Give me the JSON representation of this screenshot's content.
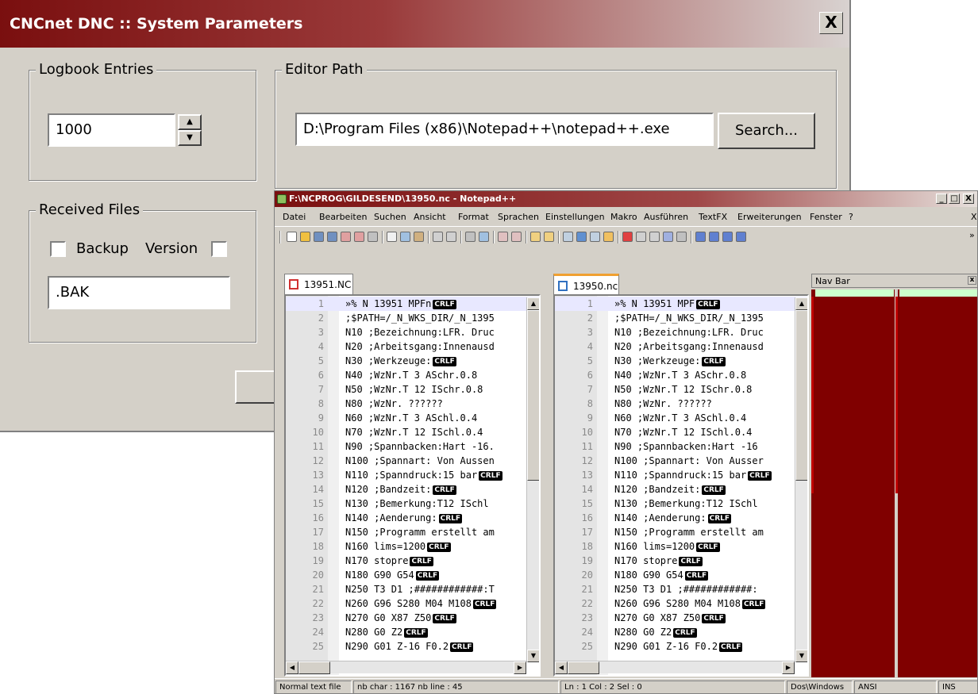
{
  "dialog": {
    "title": "CNCnet DNC :: System Parameters",
    "close_label": "X",
    "logbook": {
      "legend": "Logbook Entries",
      "value": "1000"
    },
    "editor": {
      "legend": "Editor Path",
      "path": "D:\\Program Files (x86)\\Notepad++\\notepad++.exe",
      "search_label": "Search..."
    },
    "received": {
      "legend": "Received Files",
      "backup_label": "Backup",
      "version_label": "Version",
      "extension": ".BAK"
    }
  },
  "npp": {
    "title": "F:\\NCPROG\\GILDESEND\\13950.nc - Notepad++",
    "window_buttons": {
      "minimize": "_",
      "maximize": "□",
      "close": "X"
    },
    "menu": [
      "Datei",
      "Bearbeiten",
      "Suchen",
      "Ansicht",
      "Format",
      "Sprachen",
      "Einstellungen",
      "Makro",
      "Ausführen",
      "TextFX",
      "Erweiterungen",
      "Fenster",
      "?"
    ],
    "menu_right": "X",
    "toolbar_more": "»",
    "left_tab": "13951.NC",
    "right_tab": "13950.nc",
    "crlf_label": "CRLF",
    "line_numbers": [
      "1",
      "2",
      "3",
      "4",
      "5",
      "6",
      "7",
      "8",
      "9",
      "10",
      "11",
      "12",
      "13",
      "14",
      "15",
      "16",
      "17",
      "18",
      "19",
      "20",
      "21",
      "22",
      "23",
      "24",
      "25"
    ],
    "left_lines": [
      "»% N 13951 MPFn",
      ";$PATH=/_N_WKS_DIR/_N_1395",
      "N10 ;Bezeichnung:LFR. Druc",
      "N20 ;Arbeitsgang:Innenausd",
      "N30 ;Werkzeuge:",
      "N40 ;WzNr.T 3 ASchr.0.8",
      "N50 ;WzNr.T 12 ISchr.0.8",
      "N80 ;WzNr. ??????",
      "N60 ;WzNr.T 3 ASchl.0.4",
      "N70 ;WzNr.T 12 ISchl.0.4",
      "N90 ;Spannbacken:Hart -16.",
      "N100 ;Spannart: Von Aussen",
      "N110 ;Spanndruck:15 bar",
      "N120 ;Bandzeit:",
      "N130 ;Bemerkung:T12 ISchl",
      "N140 ;Aenderung:",
      "N150 ;Programm erstellt am",
      "N160 lims=1200",
      "N170 stopre",
      "N180 G90 G54",
      "N250 T3 D1 ;############:T",
      "N260 G96 S280 M04 M108",
      "N270 G0 X87 Z50",
      "N280 G0 Z2",
      "N290 G01 Z-16 F0.2"
    ],
    "right_lines": [
      "»% N 13951 MPF",
      ";$PATH=/_N_WKS_DIR/_N_1395",
      "N10 ;Bezeichnung:LFR. Druc",
      "N20 ;Arbeitsgang:Innenausd",
      "N30 ;Werkzeuge:",
      "N40 ;WzNr.T 3 ASchr.0.8",
      "N50 ;WzNr.T 12 ISchr.0.8",
      "N80 ;WzNr. ??????",
      "N60 ;WzNr.T 3 ASchl.0.4",
      "N70 ;WzNr.T 12 ISchl.0.4",
      "N90 ;Spannbacken:Hart -16",
      "N100 ;Spannart: Von Ausser",
      "N110 ;Spanndruck:15 bar",
      "N120 ;Bandzeit:",
      "N130 ;Bemerkung:T12 ISchl",
      "N140 ;Aenderung:",
      "N150 ;Programm erstellt am",
      "N160 lims=1200",
      "N170 stopre",
      "N180 G90 G54",
      "N250 T3 D1 ;############:",
      "N260 G96 S280 M04 M108",
      "N270 G0 X87 Z50",
      "N280 G0 Z2",
      "N290 G01 Z-16 F0.2"
    ],
    "left_crlf": [
      true,
      false,
      false,
      false,
      true,
      false,
      false,
      false,
      false,
      false,
      false,
      false,
      true,
      true,
      false,
      true,
      false,
      true,
      true,
      true,
      false,
      true,
      true,
      true,
      true
    ],
    "right_crlf": [
      true,
      false,
      false,
      false,
      true,
      false,
      false,
      false,
      false,
      false,
      false,
      false,
      true,
      true,
      false,
      true,
      false,
      true,
      true,
      true,
      false,
      true,
      true,
      true,
      true
    ],
    "navbar": {
      "title": "Nav Bar",
      "close": "x"
    },
    "status": {
      "filetype": "Normal text file",
      "counts": "nb char : 1167    nb line : 45",
      "position": "Ln : 1    Col : 2    Sel : 0",
      "eol": "Dos\\Windows",
      "encoding": "ANSI",
      "mode": "INS"
    },
    "colors": {
      "nav_bar": "#800000",
      "title_start": "#7a0f0f",
      "tab_active_accent": "#f0a030"
    }
  }
}
